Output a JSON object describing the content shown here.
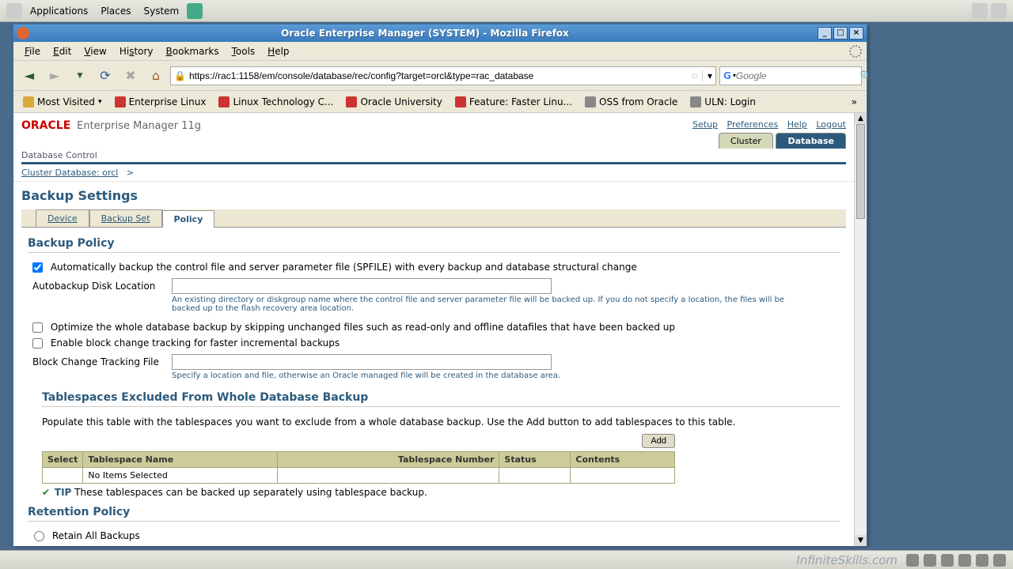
{
  "panel": {
    "apps": "Applications",
    "places": "Places",
    "system": "System"
  },
  "window": {
    "title": "Oracle Enterprise Manager (SYSTEM) - Mozilla Firefox"
  },
  "menubar": {
    "file": "File",
    "edit": "Edit",
    "view": "View",
    "history": "History",
    "bookmarks": "Bookmarks",
    "tools": "Tools",
    "help": "Help"
  },
  "url": "https://rac1:1158/em/console/database/rec/config?target=orcl&type=rac_database",
  "search_placeholder": "Google",
  "bookmarks": {
    "mv": "Most Visited",
    "el": "Enterprise Linux",
    "ltc": "Linux Technology C...",
    "ou": "Oracle University",
    "fl": "Feature: Faster Linu...",
    "oss": "OSS from Oracle",
    "uln": "ULN: Login"
  },
  "oem": {
    "logo": "ORACLE",
    "product": "Enterprise Manager 11g",
    "sub": "Database Control",
    "links": {
      "setup": "Setup",
      "prefs": "Preferences",
      "help": "Help",
      "logout": "Logout"
    },
    "htabs": {
      "cluster": "Cluster",
      "database": "Database"
    },
    "breadcrumb_link": "Cluster Database: orcl",
    "breadcrumb_sep": ">",
    "page_title": "Backup Settings",
    "tabs": {
      "device": "Device",
      "backupset": "Backup Set",
      "policy": "Policy"
    },
    "policy": {
      "section": "Backup Policy",
      "cb_autobk": "Automatically backup the control file and server parameter file (SPFILE) with every backup and database structural change",
      "lbl_autobk_loc": "Autobackup Disk Location",
      "hint_autobk": "An existing directory or diskgroup name where the control file and server parameter file will be backed up. If you do not specify a location, the files will be backed up to the flash recovery area location.",
      "cb_optimize": "Optimize the whole database backup by skipping unchanged files such as read-only and offline datafiles that have been backed up",
      "cb_bct": "Enable block change tracking for faster incremental backups",
      "lbl_bct_file": "Block Change Tracking File",
      "hint_bct": "Specify a location and file, otherwise an Oracle managed file will be created in the database area."
    },
    "excl": {
      "title": "Tablespaces Excluded From Whole Database Backup",
      "desc": "Populate this table with the tablespaces you want to exclude from a whole database backup. Use the Add button to add tablespaces to this table.",
      "add": "Add",
      "cols": {
        "select": "Select",
        "name": "Tablespace Name",
        "num": "Tablespace Number",
        "status": "Status",
        "contents": "Contents"
      },
      "empty": "No Items Selected",
      "tip_label": "TIP",
      "tip": "These tablespaces can be backed up separately using tablespace backup."
    },
    "retention": {
      "title": "Retention Policy",
      "r_all": "Retain All Backups"
    }
  },
  "watermark": "InfiniteSkills.com"
}
